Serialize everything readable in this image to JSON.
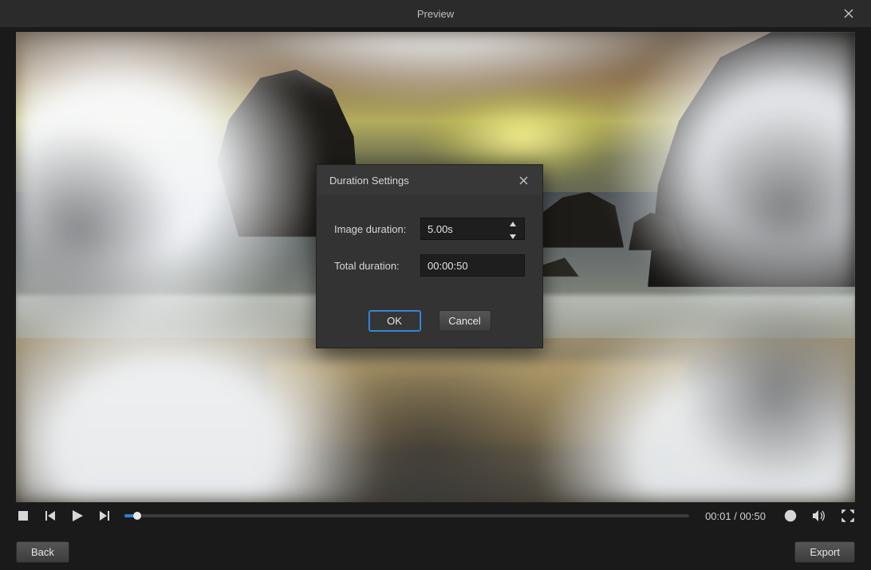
{
  "titlebar": {
    "title": "Preview"
  },
  "dialog": {
    "title": "Duration Settings",
    "image_duration_label": "Image duration:",
    "image_duration_value": "5.00s",
    "total_duration_label": "Total duration:",
    "total_duration_value": "00:00:50",
    "ok_label": "OK",
    "cancel_label": "Cancel"
  },
  "player": {
    "current_time": "00:01",
    "total_time": "00:50",
    "time_separator": " / "
  },
  "footer": {
    "back_label": "Back",
    "export_label": "Export"
  }
}
